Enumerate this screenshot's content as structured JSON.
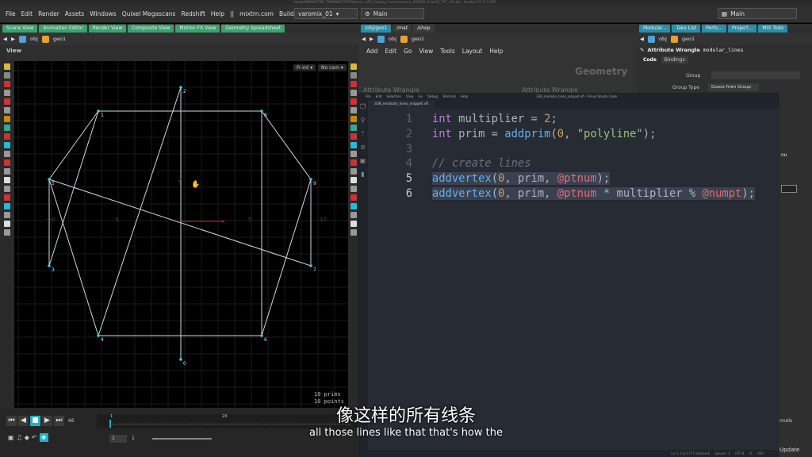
{
  "menubar": {
    "items": [
      "File",
      "Edit",
      "Render",
      "Assets",
      "Windows",
      "Quixel Megascans",
      "Redshift",
      "Help",
      "||",
      "mixtrn.com",
      "Build: 17.0.497"
    ],
    "desktop": "varomix_01",
    "main_left": "Main",
    "main_right": "Main"
  },
  "left_pane": {
    "tabs": [
      "Scene View",
      "Animation Editor",
      "Render View",
      "Composite View",
      "Motion FX View",
      "Geometry Spreadsheet"
    ],
    "path": [
      "obj",
      "geo1"
    ],
    "view_label": "View",
    "front_btn": "Front",
    "cam_btn": "No cam"
  },
  "viewport": {
    "point_labels": [
      "0",
      "1",
      "2",
      "3",
      "4",
      "5",
      "6",
      "7",
      "8",
      "9"
    ],
    "axis_labels": [
      "-10",
      "-5",
      "5",
      "10"
    ],
    "info": [
      "10  prims",
      "10  points"
    ],
    "x_label": "x",
    "y_label": "y"
  },
  "mid_pane": {
    "tabs": [
      "/obj/geo1",
      "/mat",
      "/shop"
    ],
    "path": [
      "obj",
      "geo1"
    ],
    "menu": [
      "Add",
      "Edit",
      "Go",
      "View",
      "Tools",
      "Layout",
      "Help"
    ],
    "geometry_label": "Geometry",
    "aw_label": "Attribute Wrangle"
  },
  "right_pane": {
    "tabs": [
      "Modular...",
      "Take List",
      "Perfo...",
      "Project...",
      "MIX Todo"
    ],
    "path": [
      "obj",
      "geo1"
    ],
    "node_type": "Attribute Wrangle",
    "node_name": "modular_lines",
    "subtabs": [
      "Code",
      "Bindings"
    ],
    "group_label": "Group",
    "group_type_label": "Group Type",
    "group_type_value": "Guess from Group",
    "update": "Update",
    "channels": "nnels",
    "nu": "nu"
  },
  "vscode": {
    "menu": [
      "File",
      "Edit",
      "Selection",
      "View",
      "Go",
      "Debug",
      "Terminal",
      "Help"
    ],
    "window_title": "338_modular_lines_snippet.vfl - Visual Studio Code",
    "tab": "338_modular_lines_snippet.vfl",
    "status": [
      "Ln 5, Col 1 (77 selected)",
      "Spaces: 4",
      "UTF-8",
      "LF",
      "VEX"
    ],
    "lines": [
      {
        "n": "1",
        "parts": [
          [
            "kw",
            "int"
          ],
          [
            "pl",
            " multiplier = "
          ],
          [
            "num",
            "2"
          ],
          [
            "pl",
            ";"
          ]
        ]
      },
      {
        "n": "2",
        "parts": [
          [
            "kw",
            "int"
          ],
          [
            "pl",
            " prim = "
          ],
          [
            "fn",
            "addprim"
          ],
          [
            "pl",
            "("
          ],
          [
            "num",
            "0"
          ],
          [
            "pl",
            ", "
          ],
          [
            "str",
            "\"polyline\""
          ],
          [
            "pl",
            ");"
          ]
        ]
      },
      {
        "n": "3",
        "parts": []
      },
      {
        "n": "4",
        "parts": [
          [
            "cm",
            "// create lines"
          ]
        ]
      },
      {
        "n": "5",
        "parts": [
          [
            "fn",
            "addvertex"
          ],
          [
            "pl",
            "("
          ],
          [
            "num",
            "0"
          ],
          [
            "pl",
            ", prim, "
          ],
          [
            "var",
            "@ptnum"
          ],
          [
            "pl",
            ");"
          ]
        ],
        "hl": true
      },
      {
        "n": "6",
        "parts": [
          [
            "fn",
            "addvertex"
          ],
          [
            "pl",
            "("
          ],
          [
            "num",
            "0"
          ],
          [
            "pl",
            ", prim, "
          ],
          [
            "var",
            "@ptnum"
          ],
          [
            "pl",
            " * multiplier % "
          ],
          [
            "var",
            "@numpt"
          ],
          [
            "pl",
            ");"
          ]
        ],
        "hl": true
      }
    ]
  },
  "timeline": {
    "frame_end": "66",
    "marker_1": "1",
    "marker_24": "24",
    "start": "1",
    "current": "1"
  },
  "subtitle": {
    "zh": "像这样的所有线条",
    "en": "all those lines like that that's how the"
  }
}
